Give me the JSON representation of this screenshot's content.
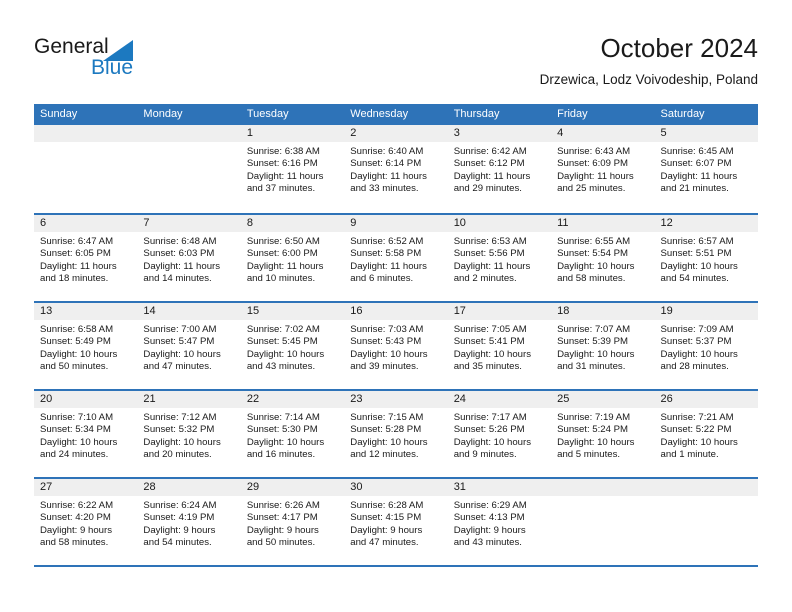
{
  "logo": {
    "text_top": "General",
    "text_bottom": "Blue",
    "triangle_icon": "blue-triangle-icon",
    "blue": "#1c79c0"
  },
  "header": {
    "title": "October 2024",
    "subtitle": "Drzewica, Lodz Voivodeship, Poland"
  },
  "theme": {
    "accent": "#2e73b8",
    "day_band": "#efefef",
    "text": "#1a1a1a"
  },
  "calendar": {
    "weekdays": [
      "Sunday",
      "Monday",
      "Tuesday",
      "Wednesday",
      "Thursday",
      "Friday",
      "Saturday"
    ],
    "weeks": [
      [
        {
          "day": "",
          "lines": []
        },
        {
          "day": "",
          "lines": []
        },
        {
          "day": "1",
          "lines": [
            "Sunrise: 6:38 AM",
            "Sunset: 6:16 PM",
            "Daylight: 11 hours",
            "and 37 minutes."
          ]
        },
        {
          "day": "2",
          "lines": [
            "Sunrise: 6:40 AM",
            "Sunset: 6:14 PM",
            "Daylight: 11 hours",
            "and 33 minutes."
          ]
        },
        {
          "day": "3",
          "lines": [
            "Sunrise: 6:42 AM",
            "Sunset: 6:12 PM",
            "Daylight: 11 hours",
            "and 29 minutes."
          ]
        },
        {
          "day": "4",
          "lines": [
            "Sunrise: 6:43 AM",
            "Sunset: 6:09 PM",
            "Daylight: 11 hours",
            "and 25 minutes."
          ]
        },
        {
          "day": "5",
          "lines": [
            "Sunrise: 6:45 AM",
            "Sunset: 6:07 PM",
            "Daylight: 11 hours",
            "and 21 minutes."
          ]
        }
      ],
      [
        {
          "day": "6",
          "lines": [
            "Sunrise: 6:47 AM",
            "Sunset: 6:05 PM",
            "Daylight: 11 hours",
            "and 18 minutes."
          ]
        },
        {
          "day": "7",
          "lines": [
            "Sunrise: 6:48 AM",
            "Sunset: 6:03 PM",
            "Daylight: 11 hours",
            "and 14 minutes."
          ]
        },
        {
          "day": "8",
          "lines": [
            "Sunrise: 6:50 AM",
            "Sunset: 6:00 PM",
            "Daylight: 11 hours",
            "and 10 minutes."
          ]
        },
        {
          "day": "9",
          "lines": [
            "Sunrise: 6:52 AM",
            "Sunset: 5:58 PM",
            "Daylight: 11 hours",
            "and 6 minutes."
          ]
        },
        {
          "day": "10",
          "lines": [
            "Sunrise: 6:53 AM",
            "Sunset: 5:56 PM",
            "Daylight: 11 hours",
            "and 2 minutes."
          ]
        },
        {
          "day": "11",
          "lines": [
            "Sunrise: 6:55 AM",
            "Sunset: 5:54 PM",
            "Daylight: 10 hours",
            "and 58 minutes."
          ]
        },
        {
          "day": "12",
          "lines": [
            "Sunrise: 6:57 AM",
            "Sunset: 5:51 PM",
            "Daylight: 10 hours",
            "and 54 minutes."
          ]
        }
      ],
      [
        {
          "day": "13",
          "lines": [
            "Sunrise: 6:58 AM",
            "Sunset: 5:49 PM",
            "Daylight: 10 hours",
            "and 50 minutes."
          ]
        },
        {
          "day": "14",
          "lines": [
            "Sunrise: 7:00 AM",
            "Sunset: 5:47 PM",
            "Daylight: 10 hours",
            "and 47 minutes."
          ]
        },
        {
          "day": "15",
          "lines": [
            "Sunrise: 7:02 AM",
            "Sunset: 5:45 PM",
            "Daylight: 10 hours",
            "and 43 minutes."
          ]
        },
        {
          "day": "16",
          "lines": [
            "Sunrise: 7:03 AM",
            "Sunset: 5:43 PM",
            "Daylight: 10 hours",
            "and 39 minutes."
          ]
        },
        {
          "day": "17",
          "lines": [
            "Sunrise: 7:05 AM",
            "Sunset: 5:41 PM",
            "Daylight: 10 hours",
            "and 35 minutes."
          ]
        },
        {
          "day": "18",
          "lines": [
            "Sunrise: 7:07 AM",
            "Sunset: 5:39 PM",
            "Daylight: 10 hours",
            "and 31 minutes."
          ]
        },
        {
          "day": "19",
          "lines": [
            "Sunrise: 7:09 AM",
            "Sunset: 5:37 PM",
            "Daylight: 10 hours",
            "and 28 minutes."
          ]
        }
      ],
      [
        {
          "day": "20",
          "lines": [
            "Sunrise: 7:10 AM",
            "Sunset: 5:34 PM",
            "Daylight: 10 hours",
            "and 24 minutes."
          ]
        },
        {
          "day": "21",
          "lines": [
            "Sunrise: 7:12 AM",
            "Sunset: 5:32 PM",
            "Daylight: 10 hours",
            "and 20 minutes."
          ]
        },
        {
          "day": "22",
          "lines": [
            "Sunrise: 7:14 AM",
            "Sunset: 5:30 PM",
            "Daylight: 10 hours",
            "and 16 minutes."
          ]
        },
        {
          "day": "23",
          "lines": [
            "Sunrise: 7:15 AM",
            "Sunset: 5:28 PM",
            "Daylight: 10 hours",
            "and 12 minutes."
          ]
        },
        {
          "day": "24",
          "lines": [
            "Sunrise: 7:17 AM",
            "Sunset: 5:26 PM",
            "Daylight: 10 hours",
            "and 9 minutes."
          ]
        },
        {
          "day": "25",
          "lines": [
            "Sunrise: 7:19 AM",
            "Sunset: 5:24 PM",
            "Daylight: 10 hours",
            "and 5 minutes."
          ]
        },
        {
          "day": "26",
          "lines": [
            "Sunrise: 7:21 AM",
            "Sunset: 5:22 PM",
            "Daylight: 10 hours",
            "and 1 minute."
          ]
        }
      ],
      [
        {
          "day": "27",
          "lines": [
            "Sunrise: 6:22 AM",
            "Sunset: 4:20 PM",
            "Daylight: 9 hours",
            "and 58 minutes."
          ]
        },
        {
          "day": "28",
          "lines": [
            "Sunrise: 6:24 AM",
            "Sunset: 4:19 PM",
            "Daylight: 9 hours",
            "and 54 minutes."
          ]
        },
        {
          "day": "29",
          "lines": [
            "Sunrise: 6:26 AM",
            "Sunset: 4:17 PM",
            "Daylight: 9 hours",
            "and 50 minutes."
          ]
        },
        {
          "day": "30",
          "lines": [
            "Sunrise: 6:28 AM",
            "Sunset: 4:15 PM",
            "Daylight: 9 hours",
            "and 47 minutes."
          ]
        },
        {
          "day": "31",
          "lines": [
            "Sunrise: 6:29 AM",
            "Sunset: 4:13 PM",
            "Daylight: 9 hours",
            "and 43 minutes."
          ]
        },
        {
          "day": "",
          "lines": []
        },
        {
          "day": "",
          "lines": []
        }
      ]
    ]
  }
}
